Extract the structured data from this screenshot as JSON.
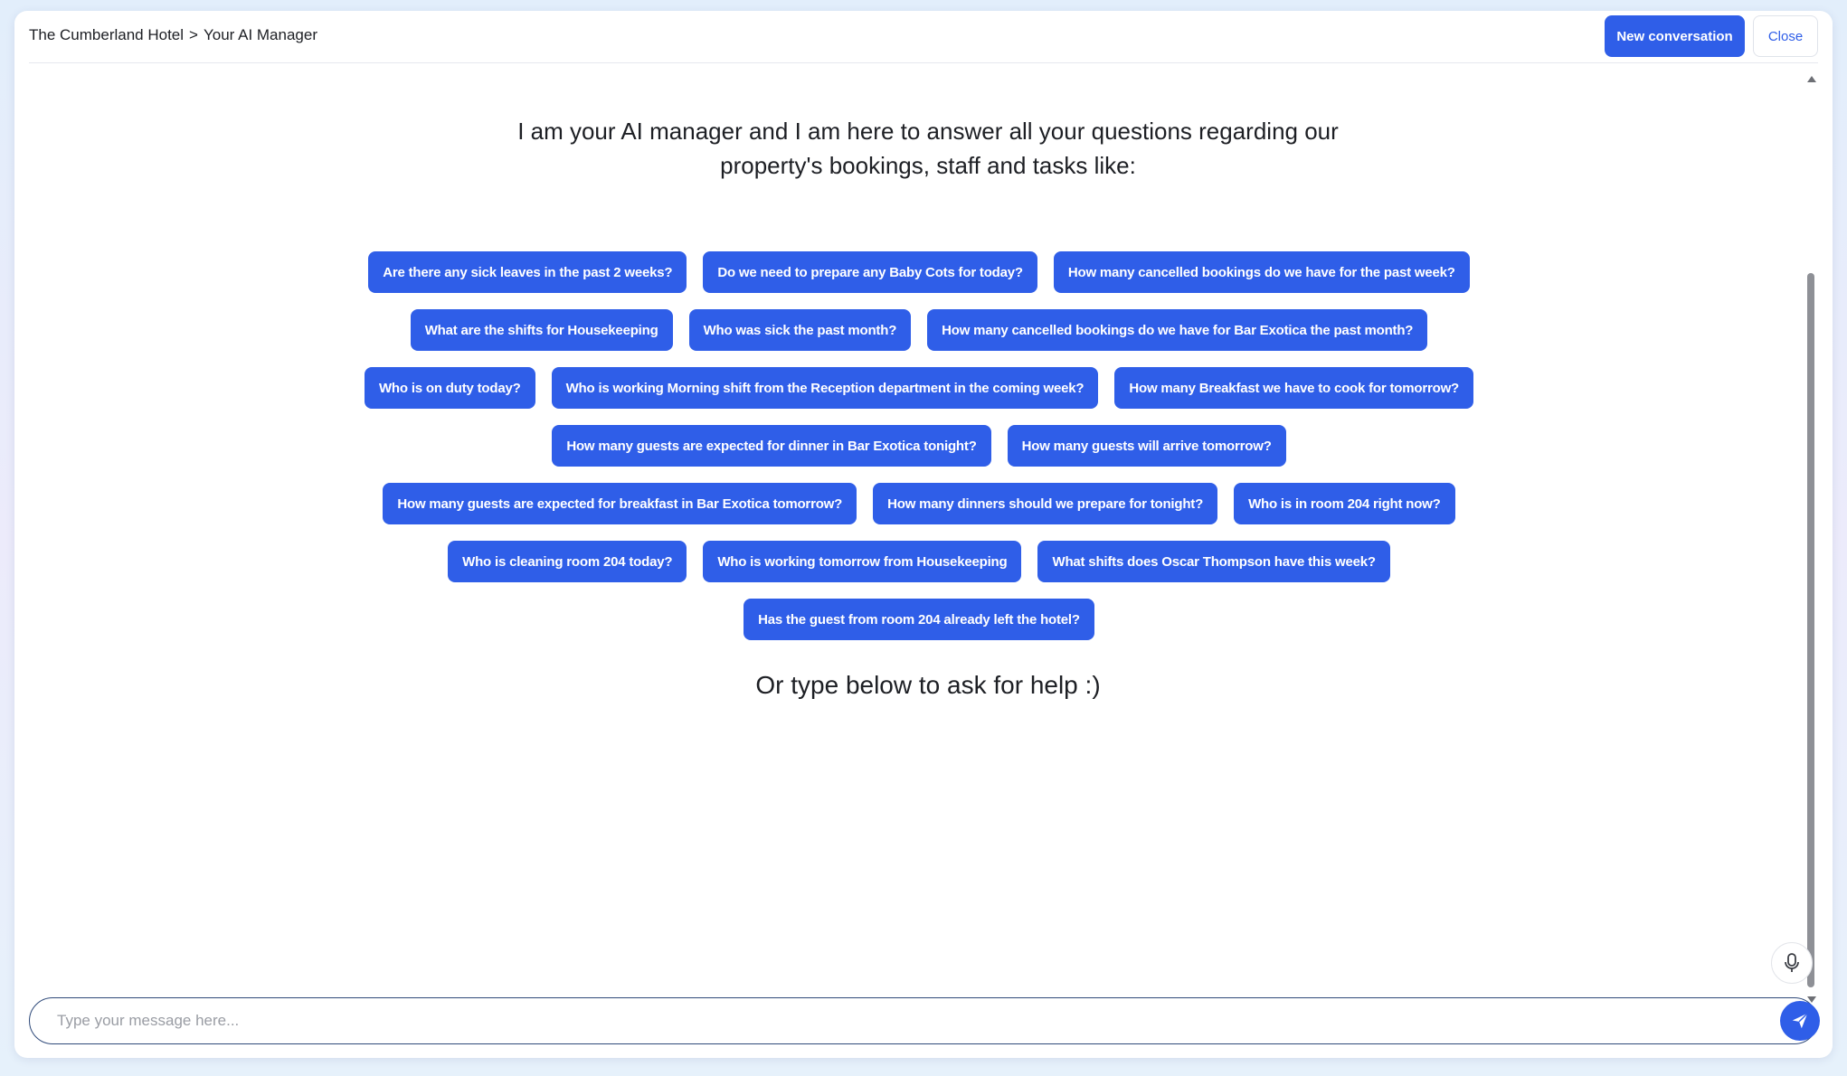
{
  "header": {
    "breadcrumb": {
      "hotel": "The Cumberland Hotel",
      "separator": ">",
      "page": "Your AI Manager"
    },
    "new_conversation_label": "New conversation",
    "close_label": "Close"
  },
  "main": {
    "intro_line1": "I am your AI manager and I am here to answer all your questions regarding our",
    "intro_line2": "property's bookings, staff and tasks like:",
    "suggestion_rows": [
      [
        "Are there any sick leaves in the past 2 weeks?",
        "Do we need to prepare any Baby Cots for today?",
        "How many cancelled bookings do we have for the past week?"
      ],
      [
        "What are the shifts for Housekeeping",
        "Who was sick the past month?",
        "How many cancelled bookings do we have for Bar Exotica the past month?"
      ],
      [
        "Who is on duty today?",
        "Who is working Morning shift from the Reception department in the coming week?",
        "How many Breakfast we have to cook for tomorrow?"
      ],
      [
        "How many guests are expected for dinner in Bar Exotica tonight?",
        "How many guests will arrive tomorrow?"
      ],
      [
        "How many guests are expected for breakfast in Bar Exotica tomorrow?",
        "How many dinners should we prepare for tonight?",
        "Who is in room 204 right now?"
      ],
      [
        "Who is cleaning room 204 today?",
        "Who is working tomorrow from Housekeeping",
        "What shifts does Oscar Thompson have this week?"
      ],
      [
        "Has the guest from room 204 already left the hotel?"
      ]
    ],
    "helper_text": "Or type below to ask for help :)"
  },
  "composer": {
    "placeholder": "Type your message here...",
    "value": "",
    "mic_icon": "microphone-icon",
    "send_icon": "send-icon"
  },
  "colors": {
    "accent": "#2f5ee8",
    "text": "#1d1f24",
    "input_border": "#2f4a7a"
  }
}
